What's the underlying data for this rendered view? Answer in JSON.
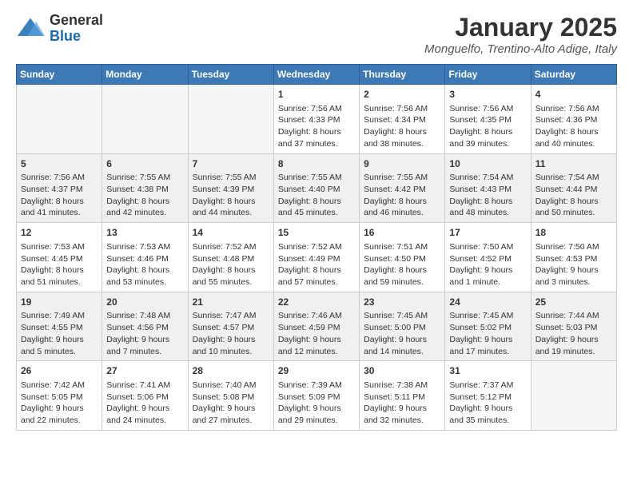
{
  "header": {
    "logo_general": "General",
    "logo_blue": "Blue",
    "month_title": "January 2025",
    "location": "Monguelfo, Trentino-Alto Adige, Italy"
  },
  "weekdays": [
    "Sunday",
    "Monday",
    "Tuesday",
    "Wednesday",
    "Thursday",
    "Friday",
    "Saturday"
  ],
  "weeks": [
    [
      {
        "day": "",
        "content": ""
      },
      {
        "day": "",
        "content": ""
      },
      {
        "day": "",
        "content": ""
      },
      {
        "day": "1",
        "content": "Sunrise: 7:56 AM\nSunset: 4:33 PM\nDaylight: 8 hours\nand 37 minutes."
      },
      {
        "day": "2",
        "content": "Sunrise: 7:56 AM\nSunset: 4:34 PM\nDaylight: 8 hours\nand 38 minutes."
      },
      {
        "day": "3",
        "content": "Sunrise: 7:56 AM\nSunset: 4:35 PM\nDaylight: 8 hours\nand 39 minutes."
      },
      {
        "day": "4",
        "content": "Sunrise: 7:56 AM\nSunset: 4:36 PM\nDaylight: 8 hours\nand 40 minutes."
      }
    ],
    [
      {
        "day": "5",
        "content": "Sunrise: 7:56 AM\nSunset: 4:37 PM\nDaylight: 8 hours\nand 41 minutes."
      },
      {
        "day": "6",
        "content": "Sunrise: 7:55 AM\nSunset: 4:38 PM\nDaylight: 8 hours\nand 42 minutes."
      },
      {
        "day": "7",
        "content": "Sunrise: 7:55 AM\nSunset: 4:39 PM\nDaylight: 8 hours\nand 44 minutes."
      },
      {
        "day": "8",
        "content": "Sunrise: 7:55 AM\nSunset: 4:40 PM\nDaylight: 8 hours\nand 45 minutes."
      },
      {
        "day": "9",
        "content": "Sunrise: 7:55 AM\nSunset: 4:42 PM\nDaylight: 8 hours\nand 46 minutes."
      },
      {
        "day": "10",
        "content": "Sunrise: 7:54 AM\nSunset: 4:43 PM\nDaylight: 8 hours\nand 48 minutes."
      },
      {
        "day": "11",
        "content": "Sunrise: 7:54 AM\nSunset: 4:44 PM\nDaylight: 8 hours\nand 50 minutes."
      }
    ],
    [
      {
        "day": "12",
        "content": "Sunrise: 7:53 AM\nSunset: 4:45 PM\nDaylight: 8 hours\nand 51 minutes."
      },
      {
        "day": "13",
        "content": "Sunrise: 7:53 AM\nSunset: 4:46 PM\nDaylight: 8 hours\nand 53 minutes."
      },
      {
        "day": "14",
        "content": "Sunrise: 7:52 AM\nSunset: 4:48 PM\nDaylight: 8 hours\nand 55 minutes."
      },
      {
        "day": "15",
        "content": "Sunrise: 7:52 AM\nSunset: 4:49 PM\nDaylight: 8 hours\nand 57 minutes."
      },
      {
        "day": "16",
        "content": "Sunrise: 7:51 AM\nSunset: 4:50 PM\nDaylight: 8 hours\nand 59 minutes."
      },
      {
        "day": "17",
        "content": "Sunrise: 7:50 AM\nSunset: 4:52 PM\nDaylight: 9 hours\nand 1 minute."
      },
      {
        "day": "18",
        "content": "Sunrise: 7:50 AM\nSunset: 4:53 PM\nDaylight: 9 hours\nand 3 minutes."
      }
    ],
    [
      {
        "day": "19",
        "content": "Sunrise: 7:49 AM\nSunset: 4:55 PM\nDaylight: 9 hours\nand 5 minutes."
      },
      {
        "day": "20",
        "content": "Sunrise: 7:48 AM\nSunset: 4:56 PM\nDaylight: 9 hours\nand 7 minutes."
      },
      {
        "day": "21",
        "content": "Sunrise: 7:47 AM\nSunset: 4:57 PM\nDaylight: 9 hours\nand 10 minutes."
      },
      {
        "day": "22",
        "content": "Sunrise: 7:46 AM\nSunset: 4:59 PM\nDaylight: 9 hours\nand 12 minutes."
      },
      {
        "day": "23",
        "content": "Sunrise: 7:45 AM\nSunset: 5:00 PM\nDaylight: 9 hours\nand 14 minutes."
      },
      {
        "day": "24",
        "content": "Sunrise: 7:45 AM\nSunset: 5:02 PM\nDaylight: 9 hours\nand 17 minutes."
      },
      {
        "day": "25",
        "content": "Sunrise: 7:44 AM\nSunset: 5:03 PM\nDaylight: 9 hours\nand 19 minutes."
      }
    ],
    [
      {
        "day": "26",
        "content": "Sunrise: 7:42 AM\nSunset: 5:05 PM\nDaylight: 9 hours\nand 22 minutes."
      },
      {
        "day": "27",
        "content": "Sunrise: 7:41 AM\nSunset: 5:06 PM\nDaylight: 9 hours\nand 24 minutes."
      },
      {
        "day": "28",
        "content": "Sunrise: 7:40 AM\nSunset: 5:08 PM\nDaylight: 9 hours\nand 27 minutes."
      },
      {
        "day": "29",
        "content": "Sunrise: 7:39 AM\nSunset: 5:09 PM\nDaylight: 9 hours\nand 29 minutes."
      },
      {
        "day": "30",
        "content": "Sunrise: 7:38 AM\nSunset: 5:11 PM\nDaylight: 9 hours\nand 32 minutes."
      },
      {
        "day": "31",
        "content": "Sunrise: 7:37 AM\nSunset: 5:12 PM\nDaylight: 9 hours\nand 35 minutes."
      },
      {
        "day": "",
        "content": ""
      }
    ]
  ]
}
